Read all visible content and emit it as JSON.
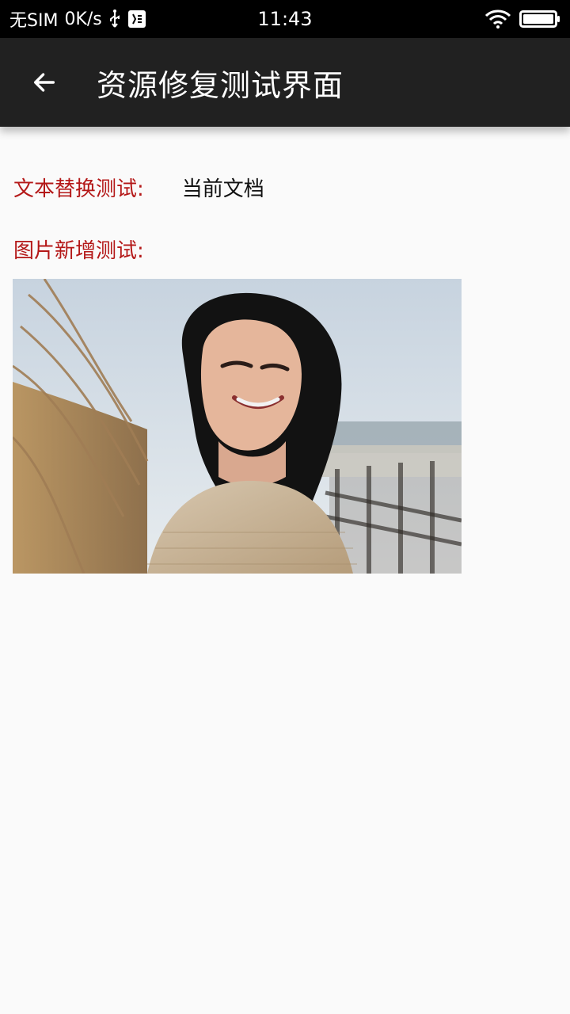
{
  "status_bar": {
    "carrier": "无SIM",
    "speed": "0K/s",
    "time": "11:43",
    "icons": [
      "usb-icon",
      "debug-icon",
      "wifi-icon",
      "battery-icon"
    ]
  },
  "app_bar": {
    "back_icon": "arrow-left-icon",
    "title": "资源修复测试界面"
  },
  "content": {
    "text_test_label": "文本替换测试:",
    "text_test_value": "当前文档",
    "image_test_label": "图片新增测试:",
    "photo": "portrait-photo"
  },
  "colors": {
    "status_bar_bg": "#000000",
    "app_bar_bg": "#212121",
    "label_red": "#b41818",
    "page_bg": "#fafafa"
  }
}
